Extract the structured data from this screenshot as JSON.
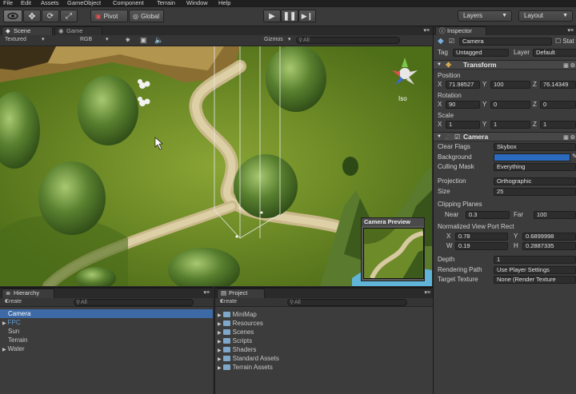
{
  "menu": [
    "File",
    "Edit",
    "Assets",
    "GameObject",
    "Component",
    "Terrain",
    "Window",
    "Help"
  ],
  "toolbar": {
    "pivot_label": "Pivot",
    "global_label": "Global",
    "layers_label": "Layers",
    "layout_label": "Layout"
  },
  "scene_tabs": {
    "scene": "Scene",
    "game": "Game"
  },
  "scene_bar": {
    "shading": "Textured",
    "render": "RGB",
    "gizmos": "Gizmos",
    "search": "All"
  },
  "scene": {
    "gizmo_mode": "Iso",
    "camera_preview_title": "Camera Preview"
  },
  "hierarchy": {
    "tab": "Hierarchy",
    "create": "Create",
    "search": "All",
    "items": [
      "Camera",
      "FPC",
      "Sun",
      "Terrain",
      "Water"
    ]
  },
  "project": {
    "tab": "Project",
    "create": "Create",
    "search": "All",
    "items": [
      "MiniMap",
      "Resources",
      "Scenes",
      "Scripts",
      "Shaders",
      "Standard Assets",
      "Terrain Assets"
    ]
  },
  "inspector": {
    "tab": "Inspector",
    "object_name": "Camera",
    "static_label": "Stat",
    "tag_label": "Tag",
    "tag_value": "Untagged",
    "layer_label": "Layer",
    "layer_value": "Default",
    "transform": {
      "title": "Transform",
      "position_label": "Position",
      "position": {
        "x": "71.98527",
        "y": "100",
        "z": "76.14349"
      },
      "rotation_label": "Rotation",
      "rotation": {
        "x": "90",
        "y": "0",
        "z": "0"
      },
      "scale_label": "Scale",
      "scale": {
        "x": "1",
        "y": "1",
        "z": "1"
      }
    },
    "camera": {
      "title": "Camera",
      "clear_flags_label": "Clear Flags",
      "clear_flags": "Skybox",
      "background_label": "Background",
      "culling_mask_label": "Culling Mask",
      "culling_mask": "Everything",
      "projection_label": "Projection",
      "projection": "Orthographic",
      "size_label": "Size",
      "size": "25",
      "clipping_label": "Clipping Planes",
      "near_label": "Near",
      "near": "0.3",
      "far_label": "Far",
      "far": "100",
      "viewport_label": "Normalized View Port Rect",
      "viewport": {
        "x": "0.78",
        "y": "0.6899998",
        "w": "0.19",
        "h": "0.2887335"
      },
      "depth_label": "Depth",
      "depth": "1",
      "rendering_path_label": "Rendering Path",
      "rendering_path": "Use Player Settings",
      "target_texture_label": "Target Texture",
      "target_texture": "None (Render Texture"
    }
  },
  "colors": {
    "background_swatch": "#2a6bbf",
    "selection": "#3d6aa6",
    "accent_blue": "#62a0d8"
  }
}
